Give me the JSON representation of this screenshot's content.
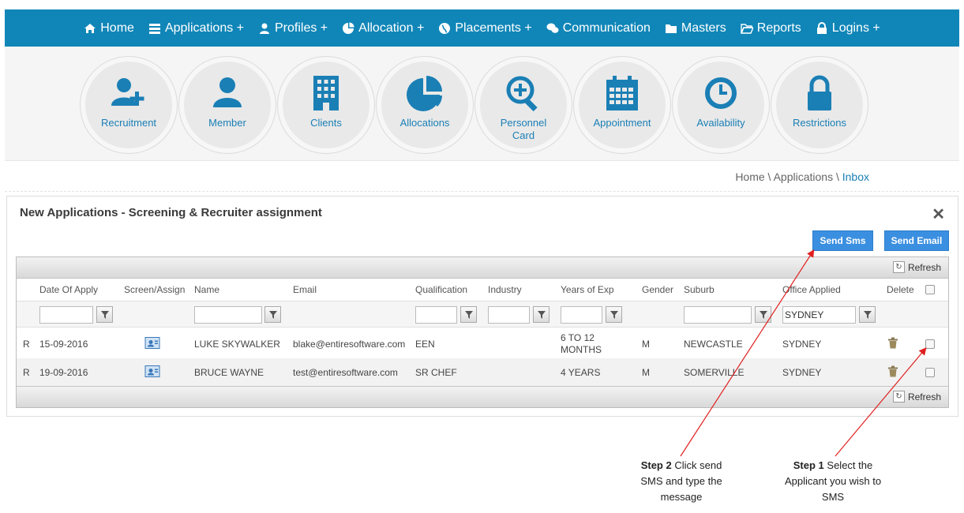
{
  "nav": {
    "items": [
      {
        "label": "Home",
        "icon": "home-icon"
      },
      {
        "label": "Applications +",
        "icon": "list-icon"
      },
      {
        "label": "Profiles +",
        "icon": "user-icon"
      },
      {
        "label": "Allocation +",
        "icon": "pie-icon"
      },
      {
        "label": "Placements +",
        "icon": "globe-icon"
      },
      {
        "label": "Communication",
        "icon": "chat-icon"
      },
      {
        "label": "Masters",
        "icon": "folder-icon"
      },
      {
        "label": "Reports",
        "icon": "folder-open-icon"
      },
      {
        "label": "Logins +",
        "icon": "lock-icon"
      }
    ]
  },
  "quicklinks": [
    {
      "label": "Recruitment",
      "icon": "add-user-icon"
    },
    {
      "label": "Member",
      "icon": "user-icon"
    },
    {
      "label": "Clients",
      "icon": "building-icon"
    },
    {
      "label": "Allocations",
      "icon": "pie-chart-icon"
    },
    {
      "label": "Personnel Card",
      "icon": "magnifier-plus-icon"
    },
    {
      "label": "Appointment",
      "icon": "calendar-icon"
    },
    {
      "label": "Availability",
      "icon": "clock-icon"
    },
    {
      "label": "Restrictions",
      "icon": "lock-icon"
    }
  ],
  "breadcrumb": {
    "home": "Home",
    "sep": " \\ ",
    "section": "Applications",
    "current": "Inbox"
  },
  "panel": {
    "title": "New Applications - Screening & Recruiter assignment",
    "send_sms": "Send Sms",
    "send_email": "Send Email",
    "refresh": "Refresh"
  },
  "table": {
    "headers": [
      "Date Of Apply",
      "Screen/Assign",
      "Name",
      "Email",
      "Qualification",
      "Industry",
      "Years of Exp",
      "Gender",
      "Suburb",
      "Office Applied",
      "Delete"
    ],
    "office_filter_value": "SYDNEY",
    "rows": [
      {
        "flag": "R",
        "date": "15-09-2016",
        "name": "LUKE SKYWALKER",
        "email": "blake@entiresoftware.com",
        "qualification": "EEN",
        "industry": "",
        "years": "6 TO 12 MONTHS",
        "gender": "M",
        "suburb": "NEWCASTLE",
        "office": "SYDNEY"
      },
      {
        "flag": "R",
        "date": "19-09-2016",
        "name": "BRUCE WAYNE",
        "email": "test@entiresoftware.com",
        "qualification": "SR CHEF",
        "industry": "",
        "years": "4 YEARS",
        "gender": "M",
        "suburb": "SOMERVILLE",
        "office": "SYDNEY"
      }
    ]
  },
  "annotations": {
    "step2_label": "Step 2",
    "step2_text": "Click send SMS and type the message",
    "step1_label": "Step 1",
    "step1_text": "Select the Applicant you wish to SMS",
    "arrow_color": "#e02020"
  },
  "colors": {
    "nav_bg": "#1086b8",
    "accent": "#1a7fb5",
    "button": "#3b8fe0"
  }
}
